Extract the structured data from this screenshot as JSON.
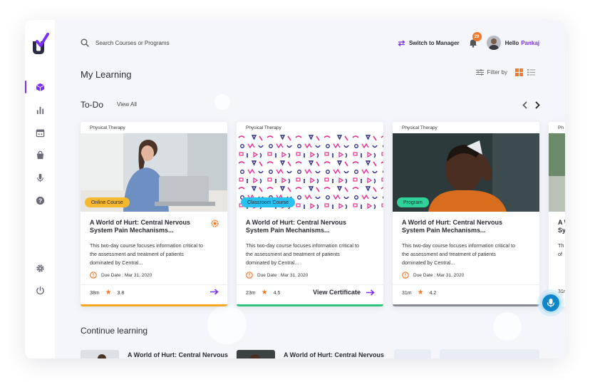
{
  "search": {
    "placeholder": "Search Courses or Programs"
  },
  "header": {
    "switch_label": "Switch to Manager",
    "notification_count": "29",
    "hello": "Hello",
    "user_name": "Pankaj"
  },
  "page": {
    "title": "My Learning",
    "filter_label": "Filter by"
  },
  "todo": {
    "title": "To-Do",
    "view_all": "View All",
    "cards": [
      {
        "category": "Physical Therapy",
        "tag": "Online Course",
        "title": "A World of Hurt: Central Nervous System Pain Mechanisms...",
        "description": "This two-day course focuses information critical to the assessment and treatment of patients dominated by Central...",
        "due": "Due Date : Mar 31, 2020",
        "duration": "38m",
        "rating": "3.8",
        "action": ""
      },
      {
        "category": "Physical Therapy",
        "tag": "Classroom Course",
        "title": "A World of Hurt: Central Nervous System Pain Mechanisms...",
        "description": "This two-day course focuses information critical to the assessment and treatment of patients dominated by Central...",
        "due": "Due Date : Mar 31, 2020",
        "duration": "23m",
        "rating": "4.5",
        "action": "View Certificate"
      },
      {
        "category": "Physical Therapy",
        "tag": "Program",
        "title": "A World of Hurt: Central Nervous System Pain Mechanisms...",
        "description": "This two-day course focuses information critical to the assessment and treatment of patients dominated by Central...",
        "due": "Due Date : Mar 31, 2020",
        "duration": "31m",
        "rating": "4.2",
        "action": ""
      },
      {
        "category": "Ph",
        "title": "A W Sy",
        "description": "Th cri of",
        "duration": "31m"
      }
    ]
  },
  "continue": {
    "title": "Continue learning",
    "items": [
      {
        "title": "A World of Hurt: Central Nervous System Pain Mechanisms"
      },
      {
        "title": "A World of Hurt: Central Nervous System Pain Mechanisms"
      }
    ]
  },
  "colors": {
    "accent": "#7b2ff7",
    "online_course": "#f5b82e",
    "classroom_course": "#29c1f2",
    "program": "#2fd39a",
    "bar_online": "#f5a623",
    "bar_classroom": "#2ec47a",
    "bar_program": "#8a8a92",
    "star": "#f5792a",
    "fab": "#0f86c9"
  },
  "icons": {
    "sidebar": [
      "courses-icon",
      "reports-icon",
      "calendar-icon",
      "bag-icon",
      "microphone-icon",
      "help-icon",
      "settings-icon",
      "power-icon"
    ],
    "header": [
      "search-icon",
      "switch-icon",
      "bell-icon"
    ],
    "card": [
      "clock-icon",
      "star-icon",
      "arrow-right-icon",
      "award-icon"
    ]
  }
}
